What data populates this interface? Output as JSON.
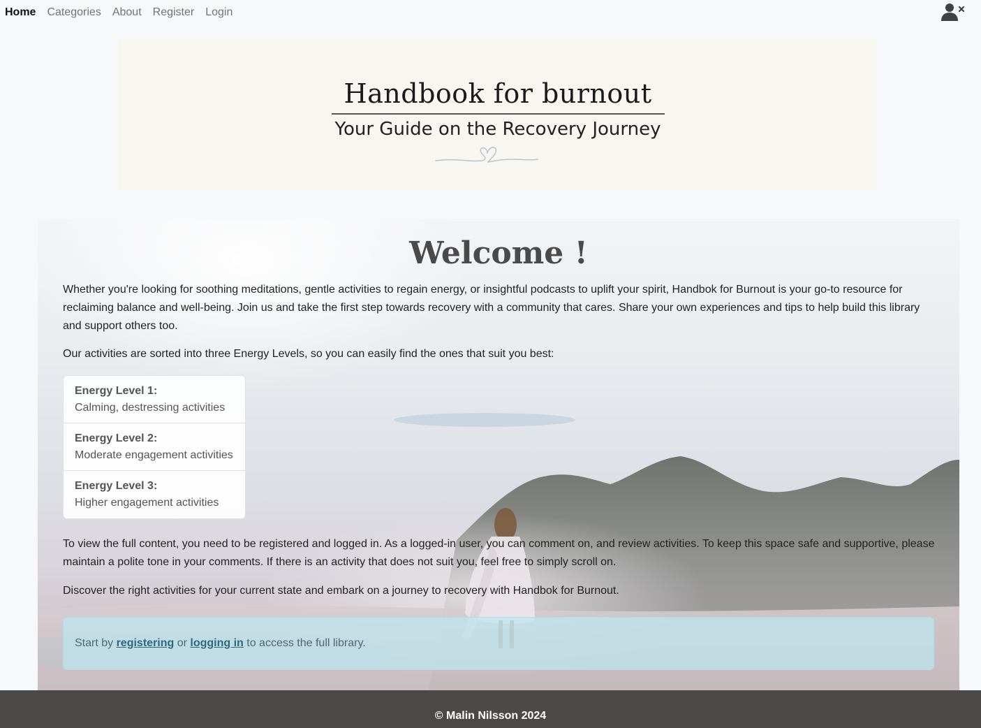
{
  "nav": {
    "home": "Home",
    "categories": "Categories",
    "about": "About",
    "register": "Register",
    "login": "Login",
    "user_icon": "user-logged-out-icon"
  },
  "banner": {
    "title": "Handbook for burnout",
    "subtitle": "Your Guide on the Recovery Journey",
    "ornament": "heart-line-ornament"
  },
  "hero": {
    "title": "Welcome !",
    "intro": "Whether you're looking for soothing meditations, gentle activities to regain energy, or insightful podcasts to uplift your spirit, Handbok for Burnout is your go-to resource for reclaiming balance and well-being. Join us and take the first step towards recovery with a community that cares. Share your own experiences and tips to help build this library and support others too.",
    "levels_intro": "Our activities are sorted into three Energy Levels, so you can easily find the ones that suit you best:",
    "energy_levels": [
      {
        "title": "Energy Level 1:",
        "desc": "Calming, destressing activities"
      },
      {
        "title": "Energy Level 2:",
        "desc": "Moderate engagement activities"
      },
      {
        "title": "Energy Level 3:",
        "desc": "Higher engagement activities"
      }
    ],
    "access_note": "To view the full content, you need to be registered and logged in. As a logged-in user, you can comment on, and review activities. To keep this space safe and supportive, please maintain a polite tone in your comments. If there is an activity that does not suit you, feel free to simply scroll on.",
    "discover": "Discover the right activities for your current state and embark on a journey to recovery with Handbok for Burnout."
  },
  "alert": {
    "prefix": "Start by ",
    "register_link": "registering",
    "middle": " or ",
    "login_link": "logging in",
    "suffix": " to access the full library."
  },
  "footer": {
    "text": "© Malin Nilsson 2024"
  }
}
